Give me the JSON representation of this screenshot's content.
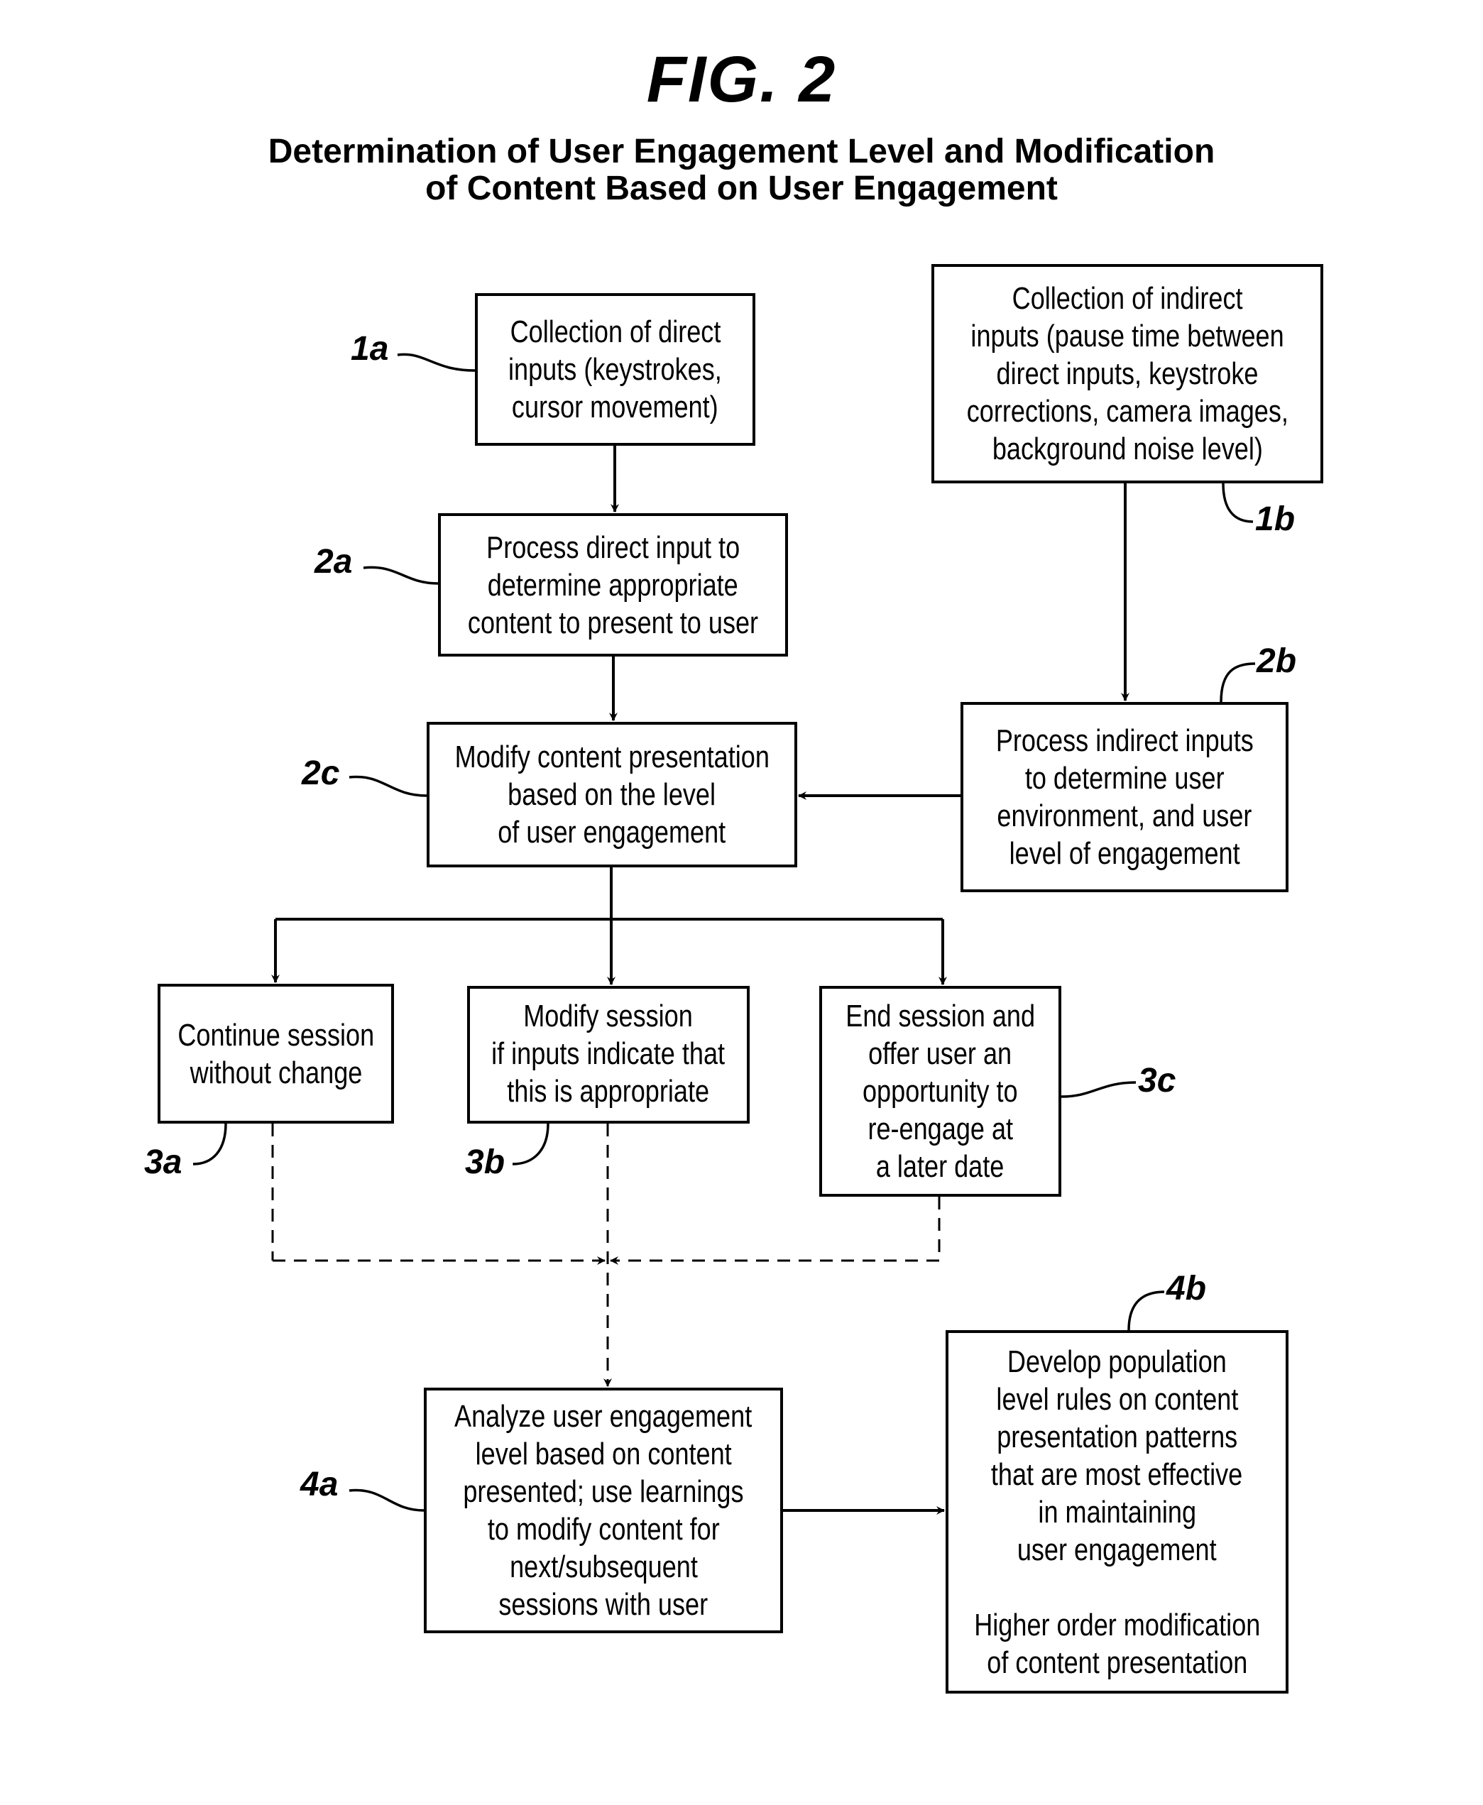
{
  "figure": {
    "title": "FIG. 2",
    "subtitle_lines": [
      "Determination of User Engagement Level and Modification",
      "of Content Based on User Engagement"
    ]
  },
  "nodes": {
    "n1a": {
      "ref": "1a",
      "lines": [
        "Collection of direct",
        "inputs (keystrokes,",
        "cursor movement)"
      ]
    },
    "n1b": {
      "ref": "1b",
      "lines": [
        "Collection of indirect",
        "inputs (pause time between",
        "direct inputs, keystroke",
        "corrections, camera images,",
        "background noise level)"
      ]
    },
    "n2a": {
      "ref": "2a",
      "lines": [
        "Process direct input to",
        "determine appropriate",
        "content to present to user"
      ]
    },
    "n2b": {
      "ref": "2b",
      "lines": [
        "Process indirect inputs",
        "to determine user",
        "environment, and user",
        "level of engagement"
      ]
    },
    "n2c": {
      "ref": "2c",
      "lines": [
        "Modify content presentation",
        "based on the level",
        "of user engagement"
      ]
    },
    "n3a": {
      "ref": "3a",
      "lines": [
        "Continue session",
        "without change"
      ]
    },
    "n3b": {
      "ref": "3b",
      "lines": [
        "Modify session",
        "if inputs indicate that",
        "this is appropriate"
      ]
    },
    "n3c": {
      "ref": "3c",
      "lines": [
        "End session and",
        "offer user an",
        "opportunity to",
        "re-engage at",
        "a later date"
      ]
    },
    "n4a": {
      "ref": "4a",
      "lines": [
        "Analyze user engagement",
        "level based on content",
        "presented; use learnings",
        "to modify content for",
        "next/subsequent",
        "sessions with user"
      ]
    },
    "n4b": {
      "ref": "4b",
      "lines": [
        "Develop population",
        "level rules on content",
        "presentation patterns",
        "that are most effective",
        "in maintaining",
        "user engagement",
        "",
        "Higher order modification",
        "of content presentation"
      ]
    }
  },
  "edges": [
    {
      "from": "1a",
      "to": "2a",
      "style": "solid"
    },
    {
      "from": "2a",
      "to": "2c",
      "style": "solid"
    },
    {
      "from": "1b",
      "to": "2b",
      "style": "solid"
    },
    {
      "from": "2b",
      "to": "2c",
      "style": "solid"
    },
    {
      "from": "2c",
      "to": "3a",
      "style": "solid"
    },
    {
      "from": "2c",
      "to": "3b",
      "style": "solid"
    },
    {
      "from": "2c",
      "to": "3c",
      "style": "solid"
    },
    {
      "from": "3a",
      "to": "4a",
      "style": "dashed"
    },
    {
      "from": "3b",
      "to": "4a",
      "style": "dashed"
    },
    {
      "from": "3c",
      "to": "4a",
      "style": "dashed"
    },
    {
      "from": "4a",
      "to": "4b",
      "style": "solid"
    }
  ]
}
